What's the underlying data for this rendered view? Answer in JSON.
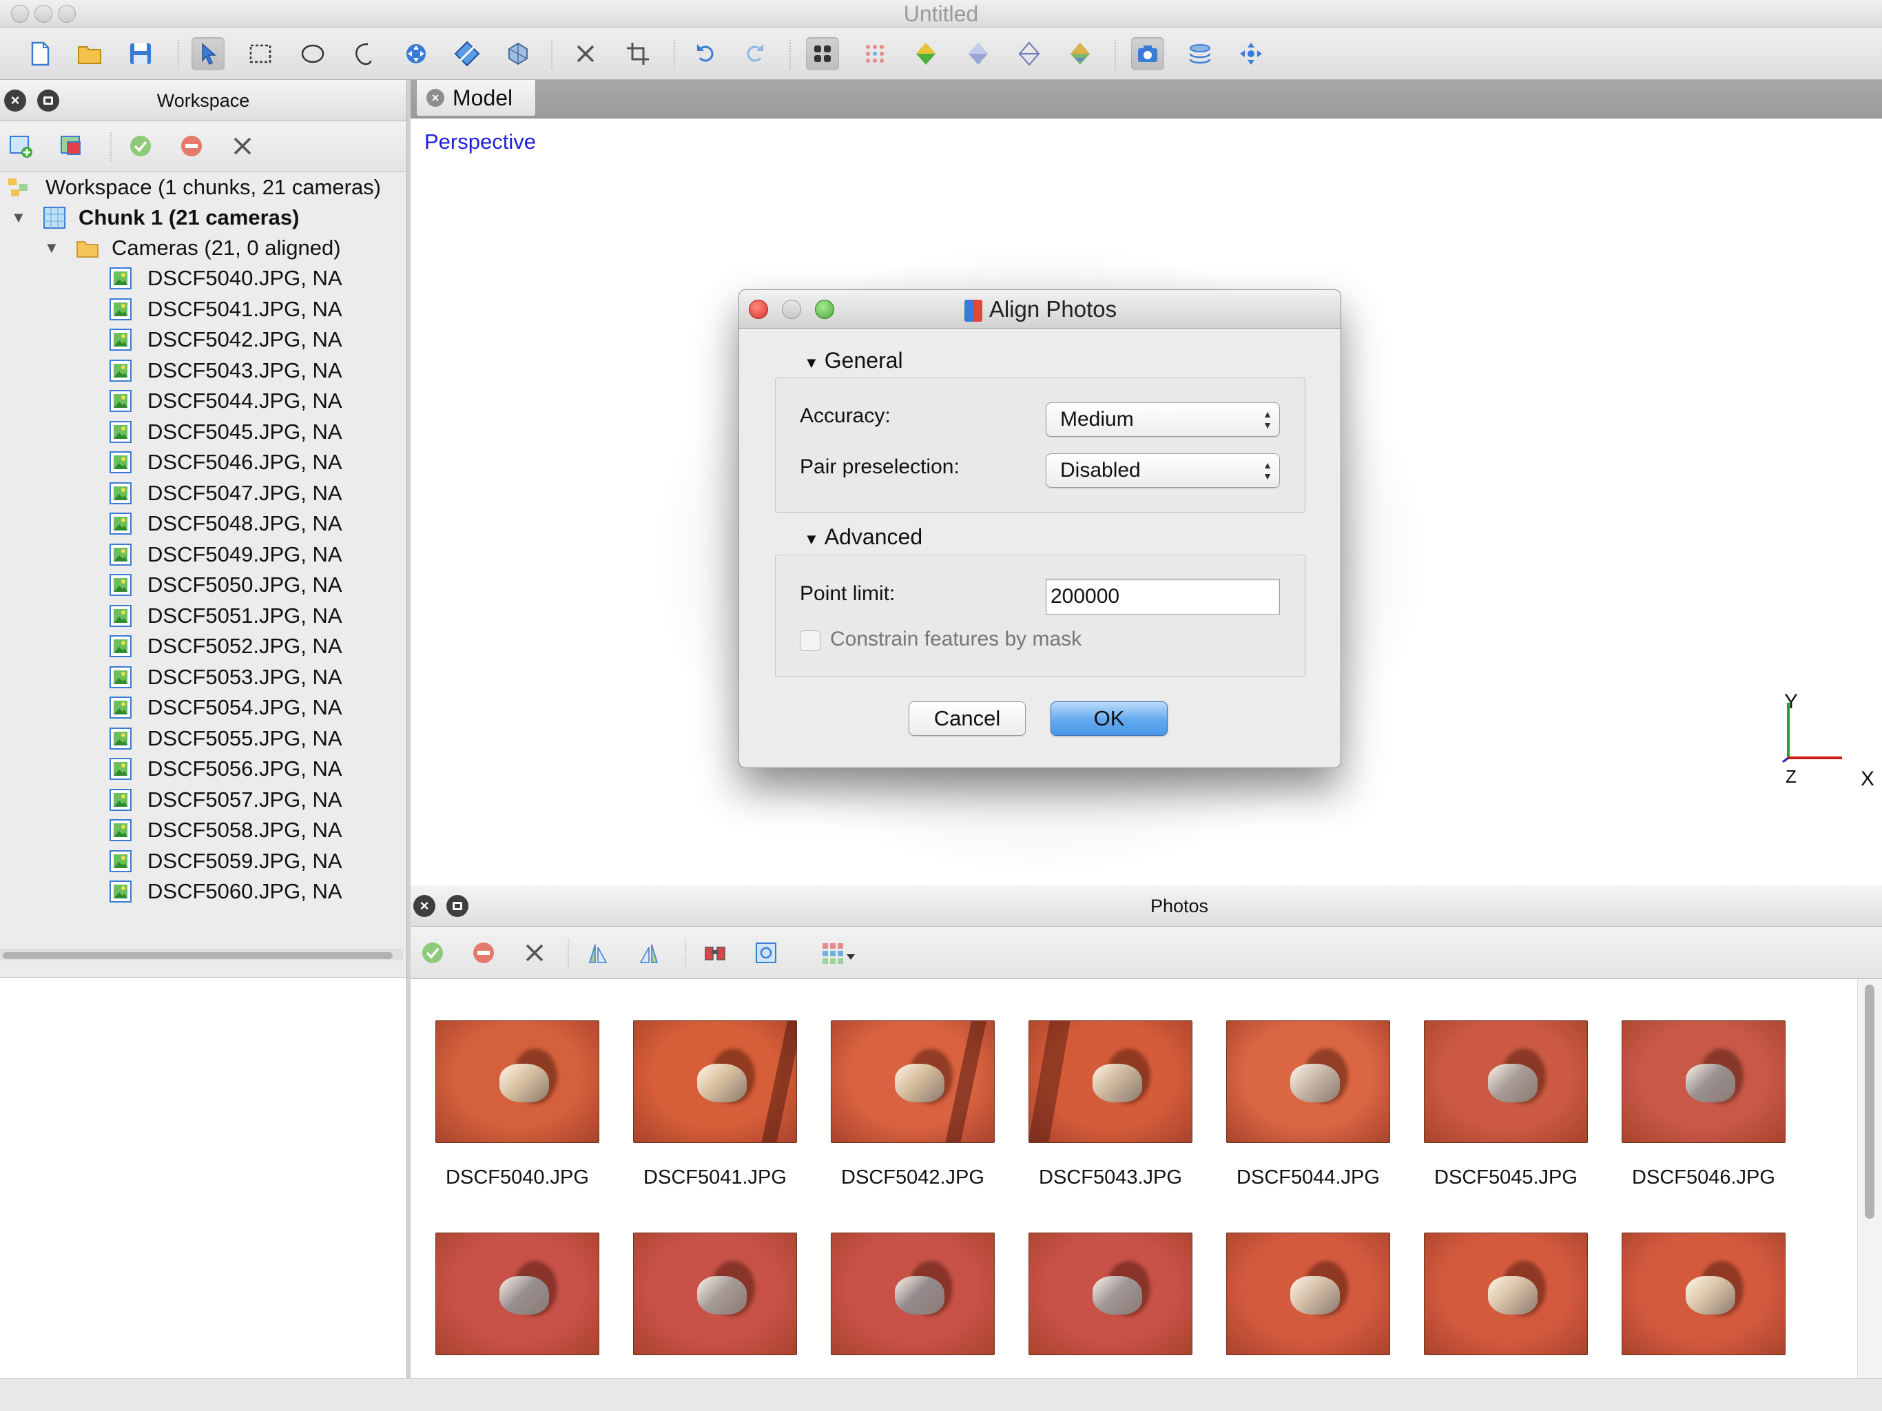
{
  "window": {
    "title": "Untitled"
  },
  "workspace_panel": {
    "title": "Workspace",
    "root": "Workspace (1 chunks, 21 cameras)",
    "chunk": "Chunk 1 (21 cameras)",
    "cameras_group": "Cameras (21, 0 aligned)",
    "cameras": [
      "DSCF5040.JPG, NA",
      "DSCF5041.JPG, NA",
      "DSCF5042.JPG, NA",
      "DSCF5043.JPG, NA",
      "DSCF5044.JPG, NA",
      "DSCF5045.JPG, NA",
      "DSCF5046.JPG, NA",
      "DSCF5047.JPG, NA",
      "DSCF5048.JPG, NA",
      "DSCF5049.JPG, NA",
      "DSCF5050.JPG, NA",
      "DSCF5051.JPG, NA",
      "DSCF5052.JPG, NA",
      "DSCF5053.JPG, NA",
      "DSCF5054.JPG, NA",
      "DSCF5055.JPG, NA",
      "DSCF5056.JPG, NA",
      "DSCF5057.JPG, NA",
      "DSCF5058.JPG, NA",
      "DSCF5059.JPG, NA",
      "DSCF5060.JPG, NA"
    ]
  },
  "model_view": {
    "tab": "Model",
    "projection": "Perspective",
    "axes": {
      "x": "X",
      "y": "Y",
      "z": "Z"
    }
  },
  "align_dialog": {
    "title": "Align Photos",
    "general_header": "General",
    "accuracy_label": "Accuracy:",
    "accuracy_value": "Medium",
    "pair_label": "Pair preselection:",
    "pair_value": "Disabled",
    "advanced_header": "Advanced",
    "point_limit_label": "Point limit:",
    "point_limit_value": "200000",
    "mask_label": "Constrain features by mask",
    "mask_checked": false,
    "cancel": "Cancel",
    "ok": "OK"
  },
  "photos_panel": {
    "title": "Photos",
    "photos": [
      "DSCF5040.JPG",
      "DSCF5041.JPG",
      "DSCF5042.JPG",
      "DSCF5043.JPG",
      "DSCF5044.JPG",
      "DSCF5045.JPG",
      "DSCF5046.JPG"
    ],
    "second_row_count": 7
  },
  "colors": {
    "accent_blue": "#1f1fe0",
    "ok_button": "#4a98e8",
    "close_red": "#e0443c",
    "minimize_yellow": "#d8d8d8",
    "zoom_green": "#58c24a",
    "soil": "#d4603c"
  }
}
